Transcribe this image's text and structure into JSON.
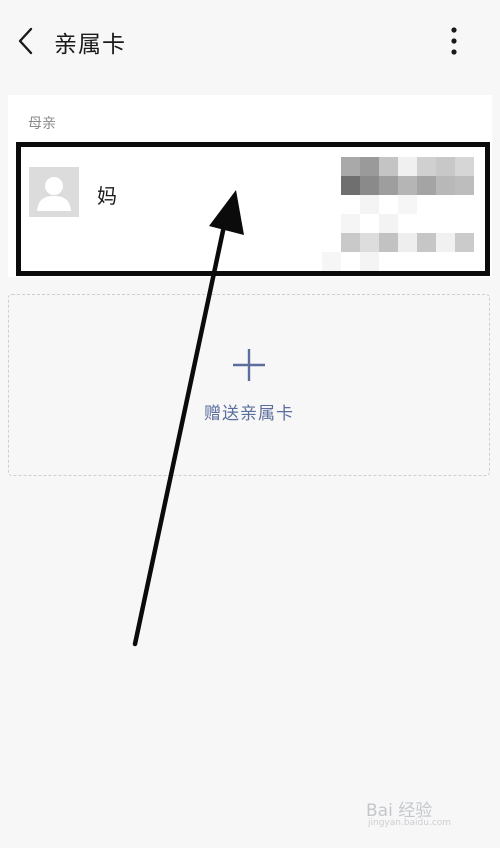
{
  "header": {
    "title": "亲属卡",
    "back_icon": "chevron-left-icon",
    "more_icon": "more-vertical-icon"
  },
  "section": {
    "label": "母亲",
    "member": {
      "name": "妈",
      "avatar_icon": "user-placeholder-icon",
      "detail_obscured": true
    }
  },
  "add_card": {
    "label": "赠送亲属卡",
    "icon": "plus-icon",
    "accent": "#5b6e9c"
  },
  "annotation": {
    "highlight_color": "#0b0b0b",
    "arrow_color": "#0b0b0b"
  },
  "watermark": {
    "brand": "Bai 经验",
    "url": "jingyan.baidu.com"
  }
}
